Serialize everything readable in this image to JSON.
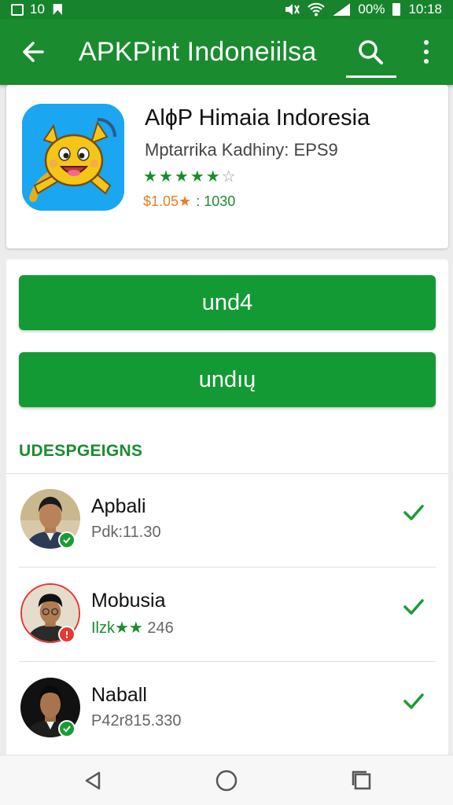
{
  "status_bar": {
    "left_text": "10",
    "battery_text": "00%",
    "time": "10:18"
  },
  "toolbar": {
    "title": "APKPint Indoneiilsa"
  },
  "app": {
    "name": "AlɸP Himaia Indoresia",
    "developer": "Mptarrika Kadhiny: EPS9",
    "rating": 5,
    "rating_max": 6,
    "price": "$1.05★",
    "count": ": 1030",
    "icon_bg": "#1aa6f0"
  },
  "buttons": {
    "primary_label": "und4",
    "secondary_label": "undıų"
  },
  "section": {
    "heading": "UDESPGEIGNS"
  },
  "list": [
    {
      "name": "Apbali",
      "sub": "Pdk:11.30",
      "sub_green": "",
      "badge": "green",
      "checked": true
    },
    {
      "name": "Mobusia",
      "sub": " 246",
      "sub_green": "Ilzk★★",
      "badge": "red",
      "checked": true
    },
    {
      "name": "Naball",
      "sub": "P42r815.330",
      "sub_green": "",
      "badge": "green",
      "checked": true
    }
  ],
  "colors": {
    "primary": "#1a8c2f",
    "button": "#139a34",
    "accent_orange": "#e67e22",
    "badge_red": "#e53935"
  }
}
